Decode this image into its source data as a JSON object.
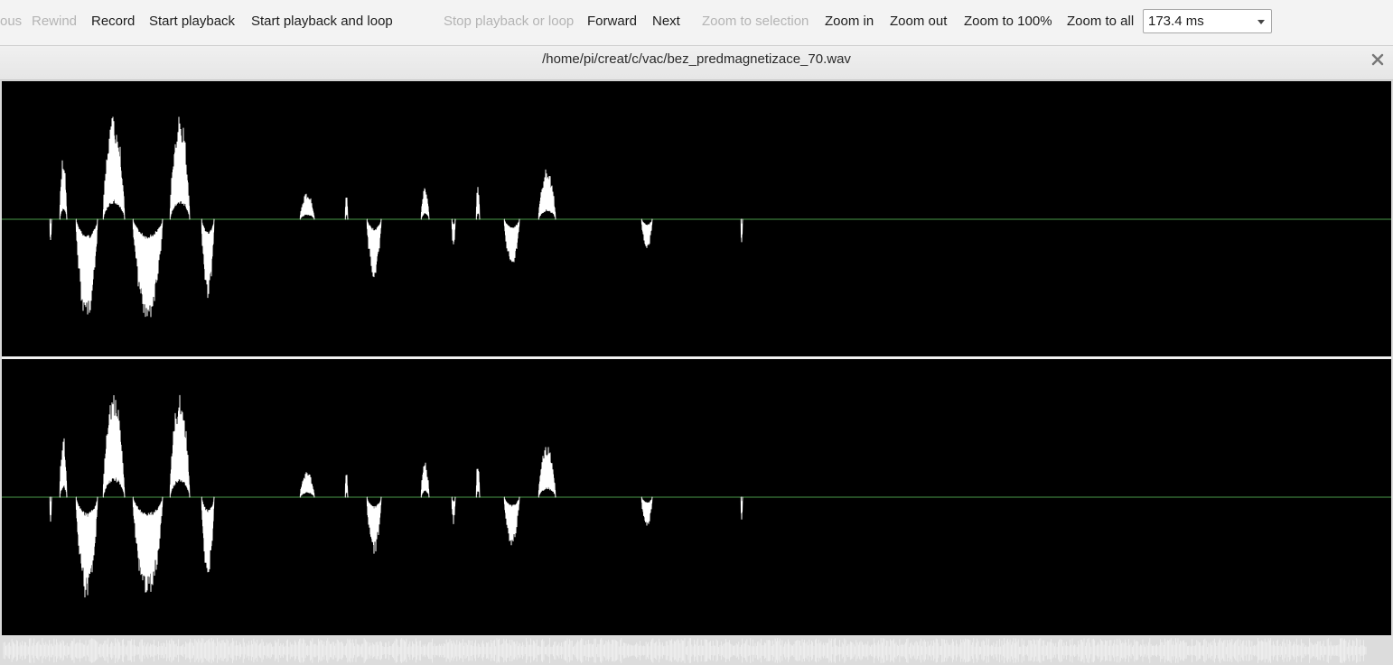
{
  "toolbar": {
    "previous_label": "ous",
    "rewind_label": "Rewind",
    "record_label": "Record",
    "start_playback_label": "Start playback",
    "start_playback_loop_label": "Start playback and loop",
    "stop_playback_label": "Stop playback or loop",
    "forward_label": "Forward",
    "next_label": "Next",
    "zoom_selection_label": "Zoom to selection",
    "zoom_in_label": "Zoom in",
    "zoom_out_label": "Zoom out",
    "zoom_100_label": "Zoom to 100%",
    "zoom_all_label": "Zoom to all",
    "zoom_value": "173.4 ms"
  },
  "file": {
    "path": "/home/pi/creat/c/vac/bez_predmagnetizace_70.wav"
  },
  "icons": {
    "close": "close-icon",
    "dropdown": "chevron-down-icon"
  },
  "colors": {
    "waveform": "#ffffff",
    "baseline": "#4a9a4a",
    "background": "#000000",
    "disabled_text": "#b4b4b4"
  }
}
